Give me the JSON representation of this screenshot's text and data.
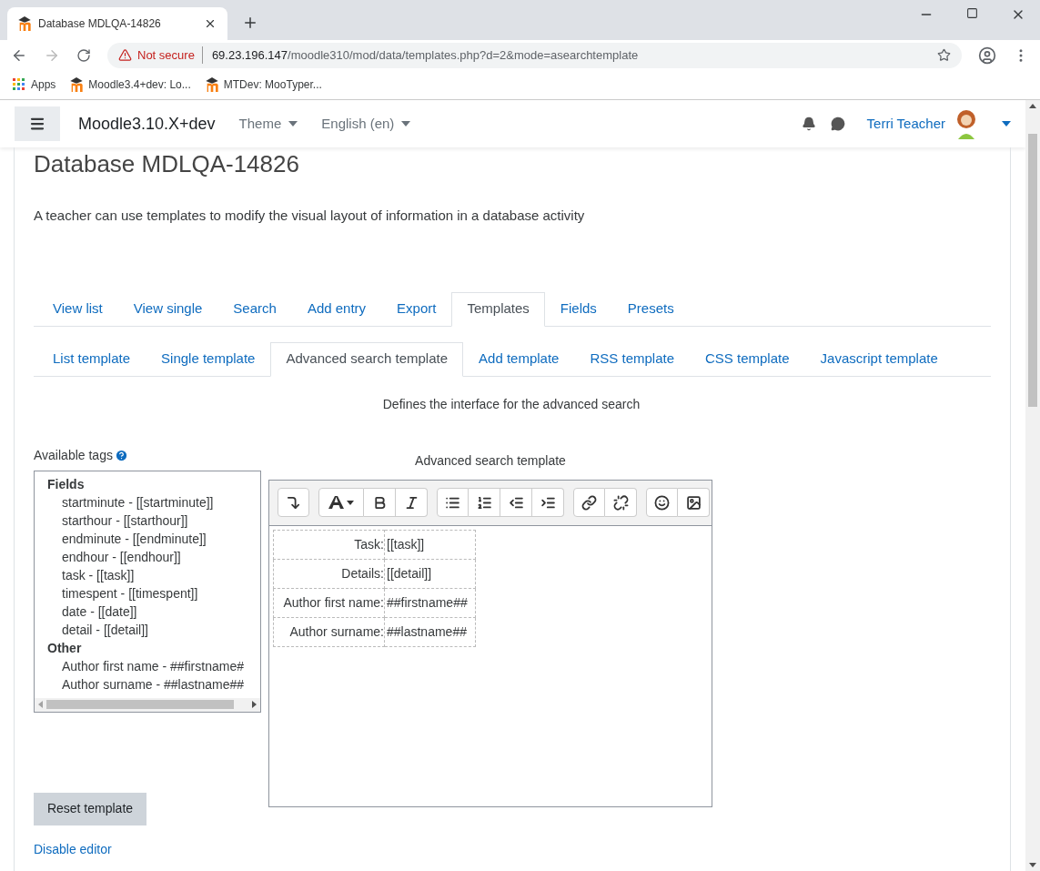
{
  "browser": {
    "tab_title": "Database MDLQA-14826",
    "not_secure": "Not secure",
    "url_host": "69.23.196.147",
    "url_path": "/moodle310/mod/data/templates.php?d=2&mode=asearchtemplate",
    "bookmarks": [
      "Apps",
      "Moodle3.4+dev: Lo...",
      "MTDev: MooTyper..."
    ]
  },
  "navbar": {
    "site_name": "Moodle3.10.X+dev",
    "menus": [
      "Theme",
      "English (en)"
    ],
    "user": "Terri Teacher"
  },
  "page": {
    "heading": "Database MDLQA-14826",
    "intro": "A teacher can use templates to modify the visual layout of information in a database activity",
    "tabs": [
      {
        "label": "View list",
        "selected": false
      },
      {
        "label": "View single",
        "selected": false
      },
      {
        "label": "Search",
        "selected": false
      },
      {
        "label": "Add entry",
        "selected": false
      },
      {
        "label": "Export",
        "selected": false
      },
      {
        "label": "Templates",
        "selected": true
      },
      {
        "label": "Fields",
        "selected": false
      },
      {
        "label": "Presets",
        "selected": false
      }
    ],
    "subtabs": [
      {
        "label": "List template",
        "selected": false
      },
      {
        "label": "Single template",
        "selected": false
      },
      {
        "label": "Advanced search template",
        "selected": true
      },
      {
        "label": "Add template",
        "selected": false
      },
      {
        "label": "RSS template",
        "selected": false
      },
      {
        "label": "CSS template",
        "selected": false
      },
      {
        "label": "Javascript template",
        "selected": false
      }
    ],
    "description": "Defines the interface for the advanced search",
    "available_tags": {
      "label": "Available tags",
      "groups": [
        {
          "title": "Fields",
          "items": [
            "startminute - [[startminute]]",
            "starthour - [[starthour]]",
            "endminute - [[endminute]]",
            "endhour - [[endhour]]",
            "task - [[task]]",
            "timespent - [[timespent]]",
            "date - [[date]]",
            "detail - [[detail]]"
          ]
        },
        {
          "title": "Other",
          "items": [
            "Author first name - ##firstname#",
            "Author surname - ##lastname##"
          ]
        }
      ]
    },
    "editor": {
      "label": "Advanced search template",
      "rows": [
        {
          "label": "Task:",
          "value": "[[task]]"
        },
        {
          "label": "Details:",
          "value": "[[detail]]"
        },
        {
          "label": "Author first name:",
          "value": "##firstname##"
        },
        {
          "label": "Author surname:",
          "value": "##lastname##"
        }
      ]
    },
    "reset_button": "Reset template",
    "disable_editor": "Disable editor"
  }
}
